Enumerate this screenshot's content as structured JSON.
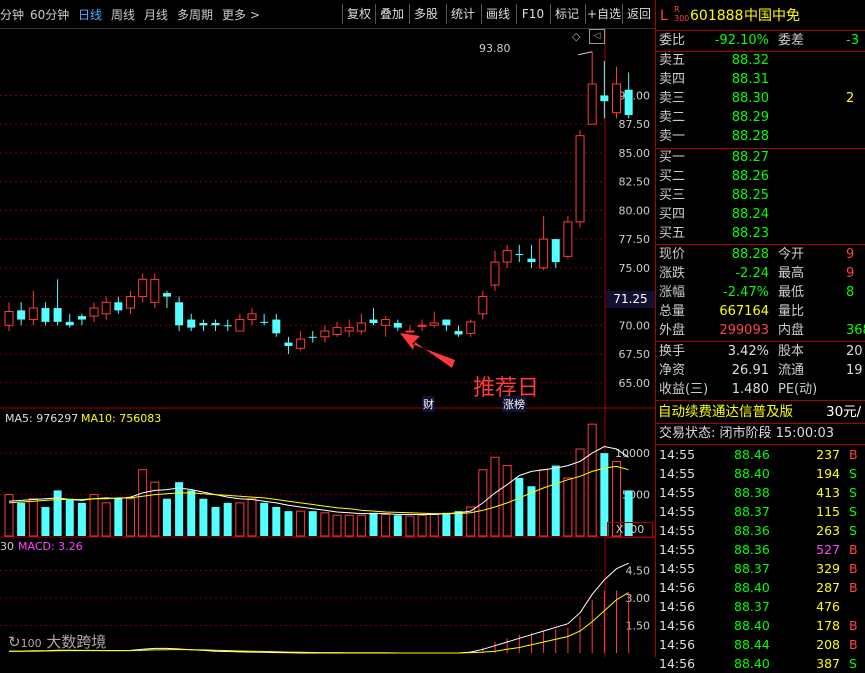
{
  "toolbar": {
    "tabs": [
      "分钟",
      "60分钟",
      "日线",
      "周线",
      "月线",
      "多周期",
      "更多"
    ],
    "active_tab": "日线",
    "more_arrow": ">",
    "buttons": [
      "复权",
      "叠加",
      "多股",
      "统计",
      "画线",
      "F10",
      "标记",
      "+自选",
      "返回"
    ]
  },
  "chart": {
    "y_ticks": [
      "90.00",
      "87.50",
      "85.00",
      "82.50",
      "80.00",
      "77.50",
      "75.00",
      "72.50",
      "70.00",
      "67.50",
      "65.00"
    ],
    "high_label": "93.80",
    "current_price_tag": "71.25",
    "annotation": "推荐日",
    "event_tag_cai": "财",
    "event_tag_zhang": "涨榜",
    "vol_legend": {
      "ma5": "MA5: 976297",
      "ma10": "MA10: 756083"
    },
    "vol_ticks": [
      "10000",
      "5000"
    ],
    "vol_unit": "X100",
    "macd_legend": {
      "prefix": "30",
      "macd": "MACD: 3.26"
    },
    "macd_ticks": [
      "4.50",
      "3.00",
      "1.50"
    ],
    "watermark": "大数跨境"
  },
  "chart_data": {
    "type": "candlestick",
    "ylim": [
      63.5,
      95
    ],
    "candles": [
      {
        "o": 70.0,
        "c": 71.2,
        "h": 72.0,
        "l": 69.5,
        "up": true
      },
      {
        "o": 71.3,
        "c": 70.5,
        "h": 72.0,
        "l": 70.0,
        "up": false
      },
      {
        "o": 70.5,
        "c": 71.5,
        "h": 73.0,
        "l": 70.0,
        "up": true
      },
      {
        "o": 71.5,
        "c": 70.3,
        "h": 72.0,
        "l": 70.0,
        "up": false
      },
      {
        "o": 70.3,
        "c": 71.5,
        "h": 74.0,
        "l": 70.0,
        "up": false
      },
      {
        "o": 70.3,
        "c": 70.0,
        "h": 71.0,
        "l": 69.8,
        "up": false
      },
      {
        "o": 70.8,
        "c": 70.5,
        "h": 71.0,
        "l": 70.0,
        "up": false
      },
      {
        "o": 70.8,
        "c": 71.5,
        "h": 72.0,
        "l": 70.3,
        "up": true
      },
      {
        "o": 71.0,
        "c": 72.0,
        "h": 72.5,
        "l": 70.5,
        "up": true
      },
      {
        "o": 72.0,
        "c": 71.3,
        "h": 72.5,
        "l": 71.0,
        "up": false
      },
      {
        "o": 71.5,
        "c": 72.5,
        "h": 73.0,
        "l": 71.0,
        "up": true
      },
      {
        "o": 72.5,
        "c": 74.0,
        "h": 74.5,
        "l": 72.0,
        "up": true
      },
      {
        "o": 74.0,
        "c": 72.0,
        "h": 74.5,
        "l": 71.5,
        "up": true
      },
      {
        "o": 72.5,
        "c": 72.8,
        "h": 73.0,
        "l": 71.5,
        "up": false
      },
      {
        "o": 72.0,
        "c": 70.0,
        "h": 72.5,
        "l": 69.5,
        "up": false
      },
      {
        "o": 70.5,
        "c": 69.8,
        "h": 71.0,
        "l": 69.5,
        "up": false
      },
      {
        "o": 70.2,
        "c": 70.0,
        "h": 70.5,
        "l": 69.5,
        "up": false
      },
      {
        "o": 70.2,
        "c": 70.0,
        "h": 70.5,
        "l": 69.5,
        "up": false
      },
      {
        "o": 70.0,
        "c": 70.0,
        "h": 70.5,
        "l": 69.5,
        "up": false
      },
      {
        "o": 69.5,
        "c": 70.5,
        "h": 71.0,
        "l": 69.5,
        "up": true
      },
      {
        "o": 70.5,
        "c": 71.0,
        "h": 71.5,
        "l": 70.0,
        "up": true
      },
      {
        "o": 70.3,
        "c": 70.3,
        "h": 71.0,
        "l": 70.0,
        "up": false
      },
      {
        "o": 70.5,
        "c": 69.3,
        "h": 71.0,
        "l": 69.0,
        "up": false
      },
      {
        "o": 68.2,
        "c": 68.5,
        "h": 69.0,
        "l": 67.5,
        "up": false
      },
      {
        "o": 68.0,
        "c": 68.8,
        "h": 69.5,
        "l": 67.8,
        "up": true
      },
      {
        "o": 69.0,
        "c": 69.0,
        "h": 69.5,
        "l": 68.5,
        "up": false
      },
      {
        "o": 69.0,
        "c": 69.5,
        "h": 70.0,
        "l": 68.5,
        "up": true
      },
      {
        "o": 69.2,
        "c": 69.8,
        "h": 70.3,
        "l": 69.0,
        "up": true
      },
      {
        "o": 69.8,
        "c": 69.5,
        "h": 70.5,
        "l": 69.0,
        "up": true
      },
      {
        "o": 69.5,
        "c": 70.2,
        "h": 71.0,
        "l": 69.2,
        "up": true
      },
      {
        "o": 70.2,
        "c": 70.5,
        "h": 71.5,
        "l": 70.0,
        "up": false
      },
      {
        "o": 70.0,
        "c": 70.5,
        "h": 70.8,
        "l": 69.0,
        "up": true
      },
      {
        "o": 70.2,
        "c": 69.8,
        "h": 70.5,
        "l": 69.5,
        "up": false
      },
      {
        "o": 69.5,
        "c": 69.5,
        "h": 70.0,
        "l": 69.5,
        "up": true
      },
      {
        "o": 70.0,
        "c": 70.0,
        "h": 70.5,
        "l": 69.5,
        "up": true
      },
      {
        "o": 70.0,
        "c": 70.2,
        "h": 71.2,
        "l": 69.8,
        "up": true
      },
      {
        "o": 70.5,
        "c": 70.0,
        "h": 70.5,
        "l": 69.5,
        "up": false
      },
      {
        "o": 69.5,
        "c": 69.2,
        "h": 70.0,
        "l": 69.0,
        "up": false
      },
      {
        "o": 69.3,
        "c": 70.3,
        "h": 70.5,
        "l": 69.0,
        "up": true
      },
      {
        "o": 71.0,
        "c": 72.5,
        "h": 73.0,
        "l": 70.5,
        "up": true
      },
      {
        "o": 73.5,
        "c": 75.5,
        "h": 76.5,
        "l": 73.0,
        "up": true
      },
      {
        "o": 75.5,
        "c": 76.5,
        "h": 77.0,
        "l": 75.0,
        "up": true
      },
      {
        "o": 76.2,
        "c": 76.2,
        "h": 77.0,
        "l": 75.5,
        "up": false
      },
      {
        "o": 75.5,
        "c": 75.8,
        "h": 77.0,
        "l": 75.0,
        "up": false
      },
      {
        "o": 75.0,
        "c": 77.5,
        "h": 79.5,
        "l": 74.8,
        "up": true
      },
      {
        "o": 77.5,
        "c": 75.5,
        "h": 77.5,
        "l": 75.0,
        "up": false
      },
      {
        "o": 76.0,
        "c": 79.0,
        "h": 79.5,
        "l": 75.8,
        "up": true
      },
      {
        "o": 79.0,
        "c": 86.5,
        "h": 87.0,
        "l": 78.5,
        "up": true
      },
      {
        "o": 87.5,
        "c": 91.0,
        "h": 93.8,
        "l": 87.5,
        "up": true
      },
      {
        "o": 90.0,
        "c": 89.5,
        "h": 93.0,
        "l": 88.0,
        "up": false
      },
      {
        "o": 88.5,
        "c": 91.0,
        "h": 92.5,
        "l": 88.0,
        "up": true
      },
      {
        "o": 90.5,
        "c": 88.3,
        "h": 92.0,
        "l": 88.0,
        "up": false
      }
    ],
    "volume_ylim": [
      0,
      14000
    ],
    "volumes": [
      5000,
      4000,
      4500,
      3500,
      5500,
      4500,
      4000,
      5000,
      4000,
      4500,
      4500,
      8000,
      6500,
      4500,
      6500,
      5500,
      4500,
      3500,
      4000,
      4000,
      4500,
      4000,
      3500,
      3000,
      3000,
      3000,
      2800,
      2500,
      2500,
      2500,
      2800,
      2600,
      2500,
      2400,
      2500,
      2600,
      2800,
      3000,
      3500,
      8000,
      9500,
      8500,
      7000,
      6000,
      8000,
      8500,
      7000,
      10500,
      13500,
      10000,
      9000,
      5500
    ],
    "ma5": [
      4200,
      4300,
      4400,
      4500,
      4600,
      4400,
      4300,
      4500,
      4600,
      4500,
      4700,
      5200,
      5500,
      5600,
      5800,
      5600,
      5300,
      5000,
      4700,
      4500,
      4400,
      4200,
      4000,
      3700,
      3500,
      3300,
      3100,
      2900,
      2800,
      2700,
      2700,
      2700,
      2600,
      2600,
      2600,
      2600,
      2700,
      2800,
      3000,
      4000,
      5200,
      6200,
      7300,
      7800,
      8000,
      8200,
      8500,
      9000,
      10000,
      10800,
      10500,
      9500
    ],
    "ma10": [
      4000,
      4100,
      4200,
      4300,
      4400,
      4400,
      4400,
      4500,
      4500,
      4600,
      4600,
      4800,
      5000,
      5100,
      5200,
      5200,
      5100,
      5000,
      4900,
      4800,
      4700,
      4600,
      4400,
      4200,
      4000,
      3800,
      3600,
      3400,
      3300,
      3100,
      3000,
      2900,
      2850,
      2800,
      2750,
      2700,
      2700,
      2700,
      2800,
      3100,
      3500,
      4000,
      4600,
      5200,
      5800,
      6300,
      6800,
      7200,
      7800,
      8200,
      8400,
      8000
    ],
    "macd_ylim": [
      0,
      6
    ],
    "macd_dif": [
      0.1,
      0.1,
      0.12,
      0.12,
      0.15,
      0.15,
      0.14,
      0.14,
      0.13,
      0.13,
      0.14,
      0.2,
      0.25,
      0.25,
      0.22,
      0.18,
      0.14,
      0.1,
      0.08,
      0.06,
      0.05,
      0.04,
      0.02,
      0.01,
      0.0,
      0.0,
      0.0,
      0.0,
      0.0,
      0.0,
      0.0,
      0.0,
      0.0,
      0.0,
      0.0,
      0.0,
      0.0,
      0.0,
      0.05,
      0.2,
      0.4,
      0.6,
      0.8,
      1.0,
      1.2,
      1.4,
      1.6,
      2.2,
      3.2,
      4.0,
      4.6,
      4.9
    ],
    "macd_dea": [
      0.1,
      0.1,
      0.1,
      0.11,
      0.12,
      0.13,
      0.13,
      0.13,
      0.13,
      0.13,
      0.13,
      0.15,
      0.17,
      0.18,
      0.19,
      0.18,
      0.17,
      0.15,
      0.13,
      0.11,
      0.1,
      0.08,
      0.07,
      0.05,
      0.04,
      0.03,
      0.02,
      0.02,
      0.01,
      0.01,
      0.01,
      0.01,
      0.0,
      0.0,
      0.0,
      0.0,
      0.0,
      0.0,
      0.02,
      0.05,
      0.1,
      0.2,
      0.3,
      0.45,
      0.6,
      0.75,
      0.9,
      1.2,
      1.7,
      2.3,
      2.9,
      3.3
    ],
    "macd_hist": [
      0,
      0,
      0,
      0,
      0,
      0,
      0,
      0,
      0,
      0,
      0,
      0,
      0,
      0,
      0,
      0,
      0,
      0,
      0,
      0,
      0,
      0,
      0,
      0,
      0,
      0,
      0,
      0,
      0,
      0,
      0,
      0,
      0,
      0,
      0,
      0,
      0,
      0,
      0.1,
      0.3,
      0.6,
      0.8,
      1.0,
      1.1,
      1.2,
      1.3,
      1.4,
      2.0,
      2.9,
      3.4,
      3.4,
      3.2
    ]
  },
  "quote": {
    "flag": "L",
    "flag_sub": "R\n300",
    "code": "601888",
    "name": "中国中免",
    "weibi_label": "委比",
    "weibi": "-92.10%",
    "weicha_label": "委差",
    "weicha": "-3",
    "asks": [
      {
        "label": "卖五",
        "price": "88.32",
        "vol": ""
      },
      {
        "label": "卖四",
        "price": "88.31",
        "vol": ""
      },
      {
        "label": "卖三",
        "price": "88.30",
        "vol": "2"
      },
      {
        "label": "卖二",
        "price": "88.29",
        "vol": ""
      },
      {
        "label": "卖一",
        "price": "88.28",
        "vol": ""
      }
    ],
    "bids": [
      {
        "label": "买一",
        "price": "88.27",
        "vol": ""
      },
      {
        "label": "买二",
        "price": "88.26",
        "vol": ""
      },
      {
        "label": "买三",
        "price": "88.25",
        "vol": ""
      },
      {
        "label": "买四",
        "price": "88.24",
        "vol": ""
      },
      {
        "label": "买五",
        "price": "88.23",
        "vol": ""
      }
    ],
    "stats": [
      {
        "l1": "现价",
        "v1": "88.28",
        "c1": "grn",
        "l2": "今开",
        "v2": "9",
        "c2": "red"
      },
      {
        "l1": "涨跌",
        "v1": "-2.24",
        "c1": "grn",
        "l2": "最高",
        "v2": "9",
        "c2": "red"
      },
      {
        "l1": "涨幅",
        "v1": "-2.47%",
        "c1": "grn",
        "l2": "最低",
        "v2": "8",
        "c2": "grn"
      },
      {
        "l1": "总量",
        "v1": "667164",
        "c1": "yel",
        "l2": "量比",
        "v2": "",
        "c2": "wht"
      },
      {
        "l1": "外盘",
        "v1": "299093",
        "c1": "red",
        "l2": "内盘",
        "v2": "368",
        "c2": "grn"
      }
    ],
    "stats2": [
      {
        "l1": "换手",
        "v1": "3.42%",
        "l2": "股本",
        "v2": "20"
      },
      {
        "l1": "净资",
        "v1": "26.91",
        "l2": "流通",
        "v2": "19"
      },
      {
        "l1": "收益(三)",
        "v1": "1.480",
        "l2": "PE(动)",
        "v2": ""
      }
    ],
    "ad": "自动续费通达信普及版",
    "ad_price": "30元/",
    "status": "交易状态: 闭市阶段 15:00:03",
    "ticks": [
      {
        "t": "14:55",
        "p": "88.46",
        "pc": "red",
        "q": "237",
        "qc": "yel",
        "s": "B",
        "sc": "red"
      },
      {
        "t": "14:55",
        "p": "88.40",
        "pc": "red",
        "q": "194",
        "qc": "yel",
        "s": "S",
        "sc": "grn"
      },
      {
        "t": "14:55",
        "p": "88.38",
        "pc": "red",
        "q": "413",
        "qc": "yel",
        "s": "S",
        "sc": "grn"
      },
      {
        "t": "14:55",
        "p": "88.37",
        "pc": "red",
        "q": "115",
        "qc": "yel",
        "s": "S",
        "sc": "grn"
      },
      {
        "t": "14:55",
        "p": "88.36",
        "pc": "red",
        "q": "263",
        "qc": "yel",
        "s": "S",
        "sc": "grn"
      },
      {
        "t": "14:55",
        "p": "88.36",
        "pc": "red",
        "q": "527",
        "qc": "mag",
        "s": "B",
        "sc": "red"
      },
      {
        "t": "14:55",
        "p": "88.37",
        "pc": "red",
        "q": "329",
        "qc": "yel",
        "s": "B",
        "sc": "red"
      },
      {
        "t": "14:56",
        "p": "88.40",
        "pc": "red",
        "q": "287",
        "qc": "yel",
        "s": "B",
        "sc": "red"
      },
      {
        "t": "14:56",
        "p": "88.37",
        "pc": "red",
        "q": "476",
        "qc": "yel",
        "s": "",
        "sc": "red"
      },
      {
        "t": "14:56",
        "p": "88.40",
        "pc": "red",
        "q": "178",
        "qc": "yel",
        "s": "B",
        "sc": "red"
      },
      {
        "t": "14:56",
        "p": "88.44",
        "pc": "red",
        "q": "208",
        "qc": "yel",
        "s": "B",
        "sc": "red"
      },
      {
        "t": "14:56",
        "p": "88.40",
        "pc": "red",
        "q": "387",
        "qc": "yel",
        "s": "S",
        "sc": "grn"
      }
    ]
  },
  "colors": {
    "up": "#ff3a3a",
    "down": "#54ffff",
    "grid": "#7a0000",
    "ma5": "#ffffff",
    "ma10": "#ffff00"
  }
}
